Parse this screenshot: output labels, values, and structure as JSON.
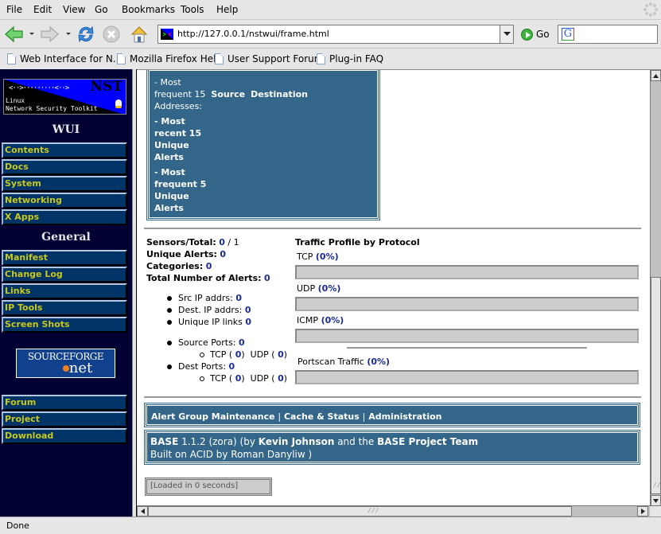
{
  "browser": {
    "menu": [
      "File",
      "Edit",
      "View",
      "Go",
      "Bookmarks",
      "Tools",
      "Help"
    ],
    "url": "http://127.0.0.1/nstwui/frame.html",
    "go_label": "Go",
    "search_engine_icon": "google-icon",
    "bookmarks": [
      "Web Interface for N...",
      "Mozilla Firefox Help",
      "User Support Forum",
      "Plug-in FAQ"
    ],
    "status": "Done"
  },
  "sidebar": {
    "logo": {
      "title": "NST",
      "line1": "Linux",
      "line2": "Network Security Toolkit",
      "arrows": "<··>·········<··>"
    },
    "section_wui": "WUI",
    "wui_items": [
      "Contents",
      "Docs",
      "System",
      "Networking",
      "X Apps"
    ],
    "section_general": "General",
    "general_items": [
      "Manifest",
      "Change Log",
      "Links",
      "IP Tools",
      "Screen Shots"
    ],
    "sourceforge": {
      "line1": "SOURCEFORGE",
      "line2": "net"
    },
    "bottom_items": [
      "Forum",
      "Project",
      "Download"
    ]
  },
  "main": {
    "menu_box": {
      "freq_prefix": "- Most",
      "freq_line": "frequent 15",
      "source": "Source",
      "destination": "Destination",
      "addresses": "Addresses:",
      "recent_alerts": [
        "- Most",
        "recent 15",
        "Unique",
        "Alerts"
      ],
      "frequent_alerts": [
        "- Most",
        "frequent 5",
        "Unique",
        "Alerts"
      ]
    },
    "stats": {
      "sensors_label": "Sensors/Total:",
      "sensors_value": "0",
      "sensors_total": " / 1",
      "unique_alerts_label": "Unique Alerts:",
      "unique_alerts_value": "0",
      "categories_label": "Categories:",
      "categories_value": "0",
      "total_alerts_label": "Total Number of Alerts:",
      "total_alerts_value": "0",
      "src_ip_label": "Src IP addrs:",
      "src_ip_value": "0",
      "dest_ip_label": "Dest. IP addrs:",
      "dest_ip_value": "0",
      "unique_links_label": "Unique IP links",
      "unique_links_value": "0",
      "source_ports_label": "Source Ports:",
      "source_ports_value": "0",
      "source_tcp": "0",
      "source_udp": "0",
      "dest_ports_label": "Dest Ports:",
      "dest_ports_value": "0",
      "dest_tcp": "0",
      "dest_udp": "0",
      "tcp_label": "TCP (",
      "udp_label": "UDP (",
      "close_paren": ")"
    },
    "traffic": {
      "title": "Traffic Profile by Protocol",
      "protocols": [
        {
          "name": "TCP",
          "percent_label": "(0%)",
          "percent": 0
        },
        {
          "name": "UDP",
          "percent_label": "(0%)",
          "percent": 0
        },
        {
          "name": "ICMP",
          "percent_label": "(0%)",
          "percent": 0
        }
      ],
      "portscan": {
        "name": "Portscan Traffic",
        "percent_label": "(0%)",
        "percent": 0
      }
    },
    "links": [
      "Alert Group Maintenance",
      "Cache & Status",
      "Administration"
    ],
    "link_separator": "|",
    "credits": {
      "base": "BASE",
      "version": " 1.1.2 (zora) (by ",
      "author": "Kevin Johnson",
      "and_the": " and the ",
      "team": "BASE Project Team",
      "line2": "Built on ACID by Roman Danyliw )"
    },
    "loaded": "[Loaded in 0 seconds]"
  }
}
